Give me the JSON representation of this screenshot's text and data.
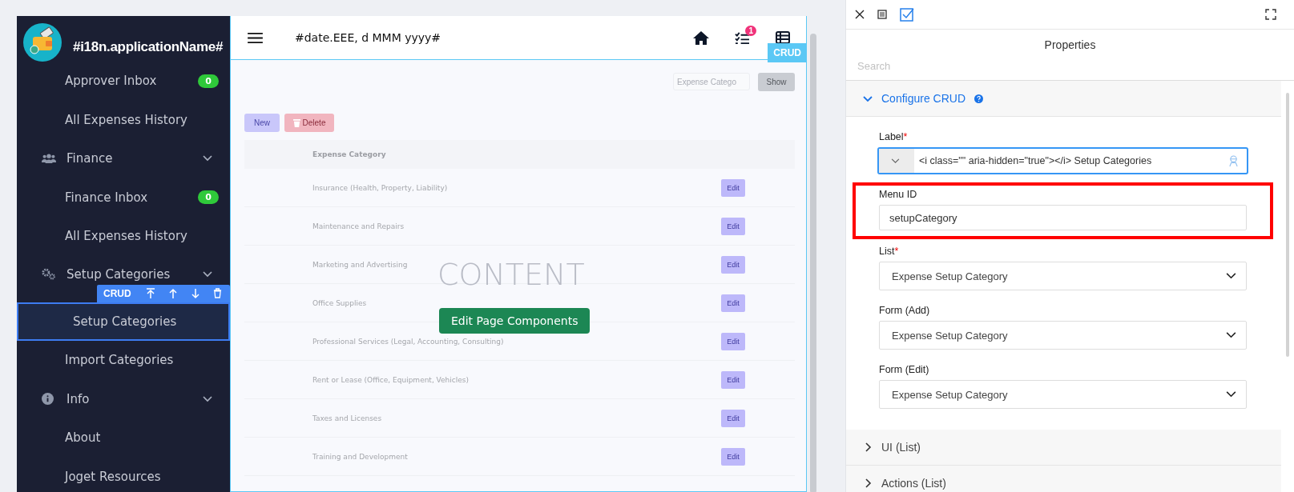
{
  "app": {
    "name": "#i18n.applicationName#",
    "date": "#date.EEE, d MMM yyyy#",
    "task_badge": "1"
  },
  "sidebar": {
    "items": [
      {
        "kind": "item",
        "label": "Approver Inbox",
        "badge": "0",
        "selected": false
      },
      {
        "kind": "item",
        "label": "All Expenses History",
        "selected": false
      },
      {
        "kind": "group",
        "label": "Finance",
        "expanded": true,
        "selected": false,
        "children": [
          {
            "kind": "item",
            "label": "Finance Inbox",
            "badge": "0",
            "selected": false
          },
          {
            "kind": "item",
            "label": "All Expenses History",
            "selected": false
          }
        ]
      },
      {
        "kind": "group",
        "label": "Setup Categories",
        "expanded": true,
        "selected": false,
        "children": [
          {
            "kind": "item",
            "label": "Setup Categories",
            "selected": true
          },
          {
            "kind": "item",
            "label": "Import Categories",
            "selected": false
          }
        ]
      },
      {
        "kind": "group",
        "label": "Info",
        "expanded": true,
        "selected": false,
        "children": [
          {
            "kind": "item",
            "label": "About",
            "selected": false
          },
          {
            "kind": "item",
            "label": "Joget Resources",
            "selected": false
          }
        ]
      }
    ]
  },
  "component_toolbar": {
    "label": "CRUD"
  },
  "content": {
    "search_placeholder": "Expense Catego",
    "show_button": "Show",
    "new_button": "New",
    "delete_button": "Delete",
    "column": "Expense Category",
    "rows": [
      {
        "category": "Insurance (Health, Property, Liability)",
        "action": "Edit"
      },
      {
        "category": "Maintenance and Repairs",
        "action": "Edit"
      },
      {
        "category": "Marketing and Advertising",
        "action": "Edit"
      },
      {
        "category": "Office Supplies",
        "action": "Edit"
      },
      {
        "category": "Professional Services (Legal, Accounting, Consulting)",
        "action": "Edit"
      },
      {
        "category": "Rent or Lease (Office, Equipment, Vehicles)",
        "action": "Edit"
      },
      {
        "category": "Taxes and Licenses",
        "action": "Edit"
      },
      {
        "category": "Training and Development",
        "action": "Edit"
      }
    ],
    "watermark": "CONTENT",
    "edit_button": "Edit Page Components",
    "tag": "CRUD"
  },
  "panel": {
    "title": "Properties",
    "search_placeholder": "Search",
    "sections": [
      {
        "title": "Configure CRUD",
        "expanded": true,
        "help": true,
        "fields": [
          {
            "kind": "icon-text",
            "label": "Label",
            "required_mark": "*",
            "highlighted": false,
            "value": "<i class=\"\" aria-hidden=\"true\"></i> Setup Categories"
          },
          {
            "kind": "text",
            "label": "Menu ID",
            "highlighted": true,
            "value": "setupCategory"
          },
          {
            "kind": "select",
            "label": "List",
            "required_mark": "*",
            "highlighted": false,
            "value": "Expense Setup Category"
          },
          {
            "kind": "select",
            "label": "Form (Add)",
            "highlighted": false,
            "value": "Expense Setup Category"
          },
          {
            "kind": "select",
            "label": "Form (Edit)",
            "highlighted": false,
            "value": "Expense Setup Category"
          }
        ]
      },
      {
        "title": "UI (List)",
        "expanded": false,
        "help": false
      },
      {
        "title": "Actions (List)",
        "expanded": false,
        "help": false
      }
    ]
  }
}
